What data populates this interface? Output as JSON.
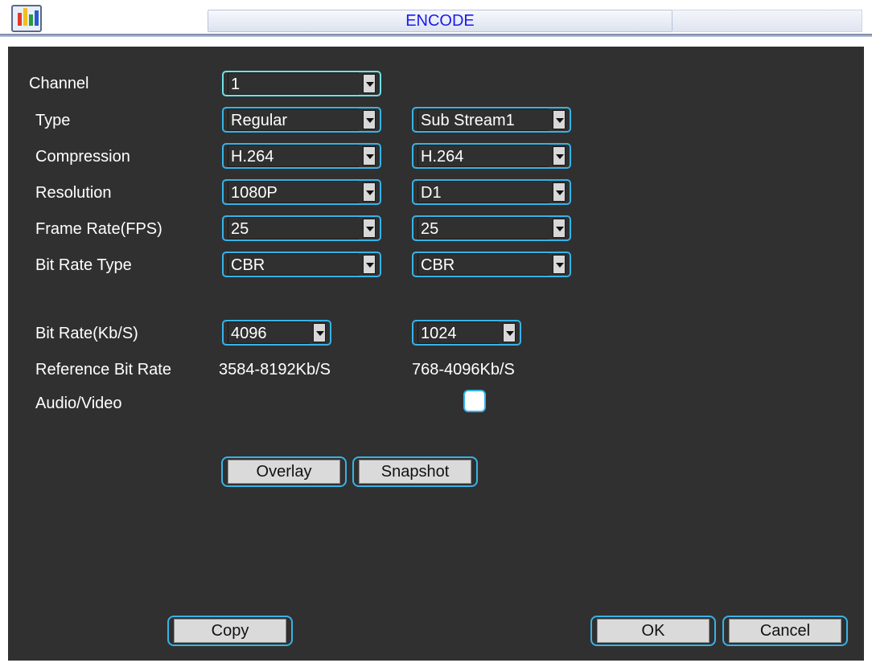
{
  "window": {
    "title": "ENCODE"
  },
  "colors": {
    "panel_bg": "#303030",
    "accent_border": "#37b3e8",
    "title_text": "#1a1af0"
  },
  "labels": {
    "channel": "Channel",
    "type": "Type",
    "compression": "Compression",
    "resolution": "Resolution",
    "frame_rate": "Frame Rate(FPS)",
    "bit_rate_type": "Bit Rate Type",
    "bit_rate": "Bit Rate(Kb/S)",
    "reference_bit_rate": "Reference Bit Rate",
    "audio_video": "Audio/Video"
  },
  "main_stream": {
    "channel": "1",
    "type": "Regular",
    "compression": "H.264",
    "resolution": "1080P",
    "frame_rate": "25",
    "bit_rate_type": "CBR",
    "bit_rate": "4096",
    "reference_bit_rate": "3584-8192Kb/S"
  },
  "sub_stream": {
    "type": "Sub Stream1",
    "compression": "H.264",
    "resolution": "D1",
    "frame_rate": "25",
    "bit_rate_type": "CBR",
    "bit_rate": "1024",
    "reference_bit_rate": "768-4096Kb/S",
    "audio_video_checked": false
  },
  "buttons": {
    "overlay": "Overlay",
    "snapshot": "Snapshot",
    "copy": "Copy",
    "ok": "OK",
    "cancel": "Cancel"
  }
}
